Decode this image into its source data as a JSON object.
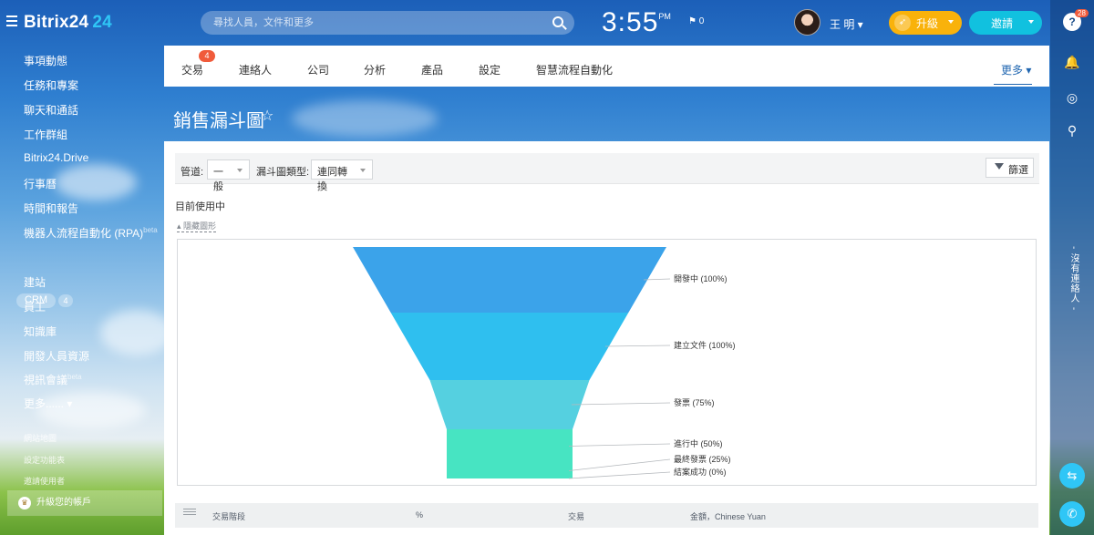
{
  "header": {
    "logo": "Bitrix24",
    "logo_num": "24",
    "search_placeholder": "尋找人員，文件和更多",
    "clock": "3:55",
    "clock_ampm": "PM",
    "flag_count": "0",
    "user": "王 明",
    "upgrade": "升級",
    "invite": "邀請"
  },
  "rail": {
    "help_badge": "28",
    "vertical_text": "- 沒有連絡人 -"
  },
  "menu": {
    "items": [
      "事項動態",
      "任務和專案",
      "聊天和通話",
      "工作群組",
      "Bitrix24.Drive",
      "行事曆",
      "時間和報告",
      "機器人流程自動化 (RPA)",
      "CRM",
      "建站",
      "員工",
      "知識庫",
      "開發人員資源",
      "視訊會議",
      "更多......"
    ],
    "rpa_sup": "beta",
    "video_sup": "beta",
    "crm_count": "4",
    "small": [
      "網站地圖",
      "設定功能表",
      "邀請使用者"
    ],
    "upgrade": "升級您的帳戶"
  },
  "tabs": {
    "items": [
      "交易",
      "連絡人",
      "公司",
      "分析",
      "產品",
      "設定",
      "智慧流程自動化"
    ],
    "deal_badge": "4",
    "more": "更多"
  },
  "page": {
    "title": "銷售漏斗圖"
  },
  "filters": {
    "pipeline_label": "管道:",
    "pipeline_value": "一般",
    "type_label": "漏斗圖類型:",
    "type_value": "連同轉換",
    "filter_btn": "篩選"
  },
  "funnel_section": {
    "current": "目前使用中",
    "hide": "隱藏圖形"
  },
  "chart_data": {
    "type": "funnel",
    "stages": [
      {
        "label": "開發中 (100%)",
        "name": "開發中",
        "value": 100,
        "color": "#3ba3ea"
      },
      {
        "label": "建立文件 (100%)",
        "name": "建立文件",
        "value": 100,
        "color": "#2fbfef"
      },
      {
        "label": "發票 (75%)",
        "name": "發票",
        "value": 75,
        "color": "#55d0e0"
      },
      {
        "label": "進行中 (50%)",
        "name": "進行中",
        "value": 50,
        "color": "#47e4c2"
      },
      {
        "label": "最終發票 (25%)",
        "name": "最終發票",
        "value": 25,
        "color": "#47e4c2"
      },
      {
        "label": "結案成功 (0%)",
        "name": "結案成功",
        "value": 0,
        "color": "#ffa900"
      }
    ]
  },
  "table": {
    "headers": [
      "交易階段",
      "%",
      "交易",
      "金額，Chinese Yuan"
    ]
  }
}
